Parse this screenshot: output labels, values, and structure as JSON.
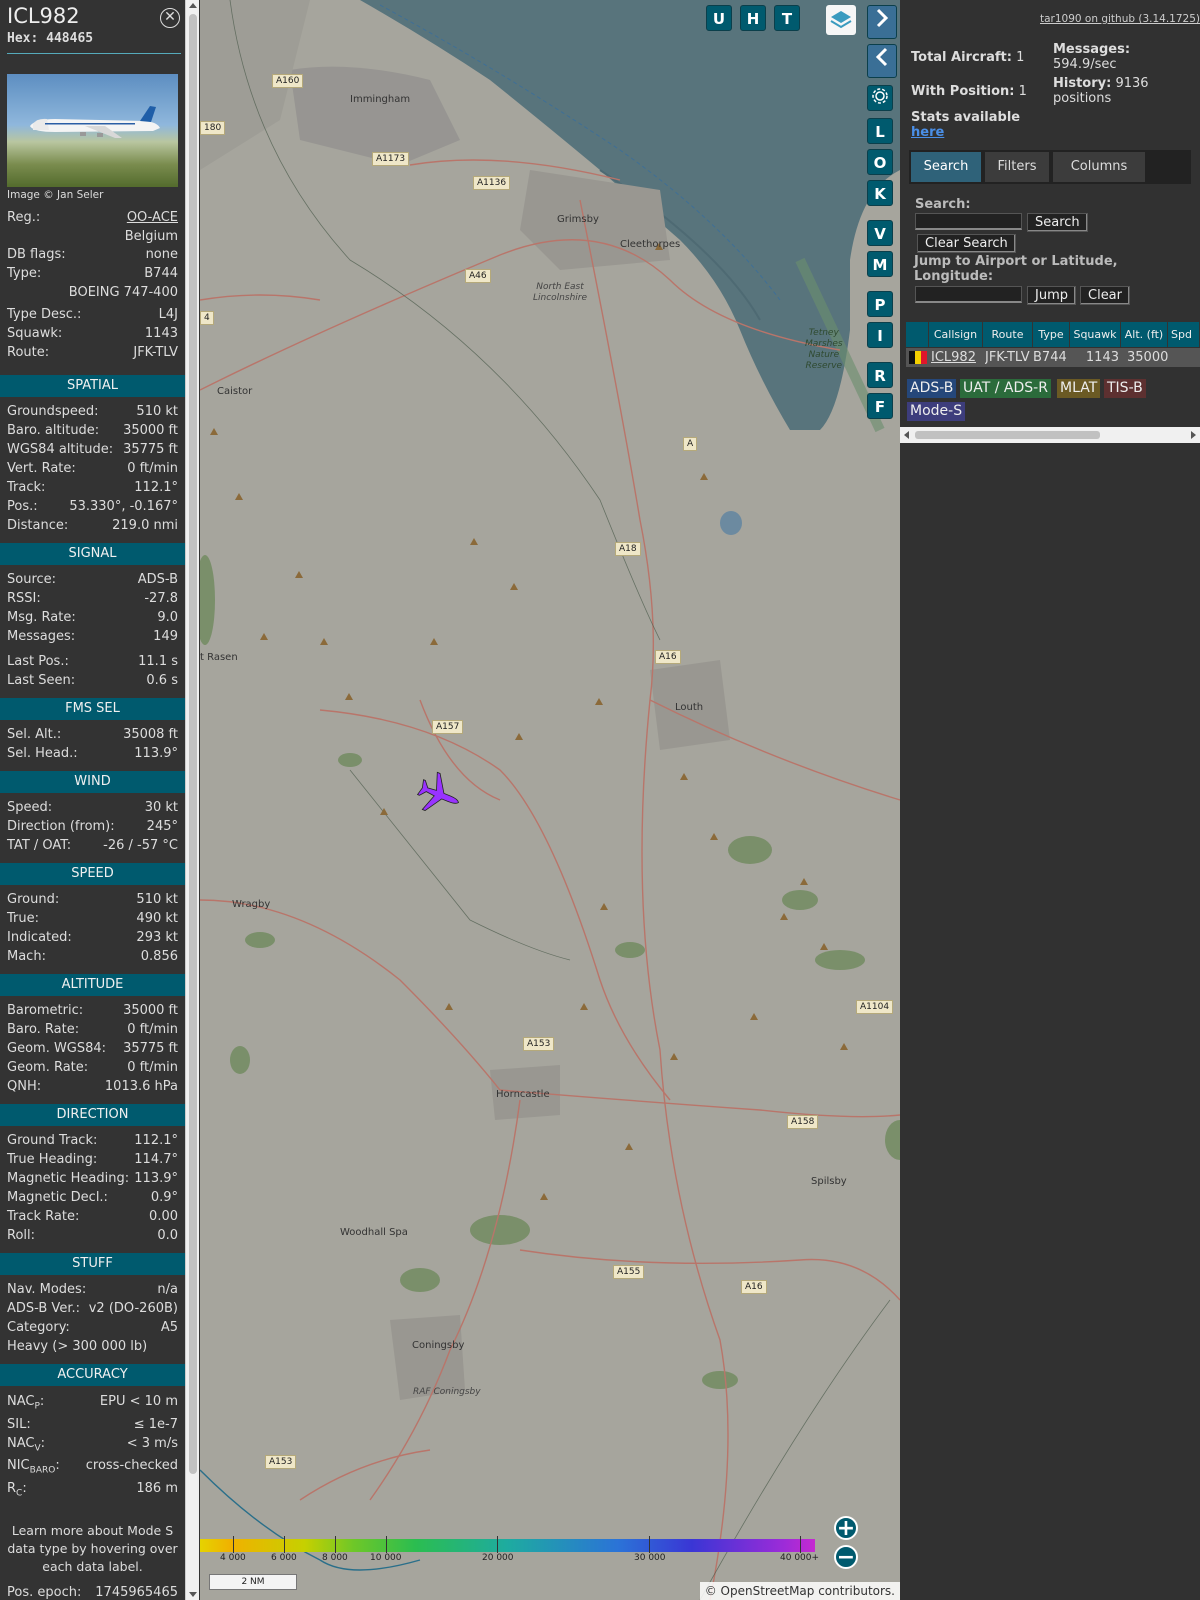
{
  "aircraft": {
    "callsign": "ICL982",
    "hex": "Hex: 448465",
    "image_credit": "Image © Jan Seler",
    "reg_label": "Reg.:",
    "reg": "OO-ACE",
    "country": "Belgium",
    "dbflags_label": "DB flags:",
    "dbflags": "none",
    "type_label": "Type:",
    "type": "B744",
    "type_name": "BOEING 747-400",
    "typedesc_label": "Type Desc.:",
    "typedesc": "L4J",
    "squawk_label": "Squawk:",
    "squawk": "1143",
    "route_label": "Route:",
    "route": "JFK-TLV"
  },
  "sections": {
    "spatial": "SPATIAL",
    "signal": "SIGNAL",
    "fms": "FMS SEL",
    "wind": "WIND",
    "speed": "SPEED",
    "altitude": "ALTITUDE",
    "direction": "DIRECTION",
    "stuff": "STUFF",
    "accuracy": "ACCURACY"
  },
  "spatial": [
    {
      "k": "Groundspeed:",
      "v": "510 kt"
    },
    {
      "k": "Baro. altitude:",
      "v": "35000 ft"
    },
    {
      "k": "WGS84 altitude:",
      "v": "35775 ft"
    },
    {
      "k": "Vert. Rate:",
      "v": "0 ft/min"
    },
    {
      "k": "Track:",
      "v": "112.1°"
    },
    {
      "k": "Pos.:",
      "v": "53.330°, -0.167°"
    },
    {
      "k": "Distance:",
      "v": "219.0 nmi"
    }
  ],
  "signal": [
    {
      "k": "Source:",
      "v": "ADS-B"
    },
    {
      "k": "RSSI:",
      "v": "-27.8"
    },
    {
      "k": "Msg. Rate:",
      "v": "9.0"
    },
    {
      "k": "Messages:",
      "v": "149"
    },
    {
      "k": "Last Pos.:",
      "v": "11.1 s"
    },
    {
      "k": "Last Seen:",
      "v": "0.6 s"
    }
  ],
  "fms": [
    {
      "k": "Sel. Alt.:",
      "v": "35008 ft"
    },
    {
      "k": "Sel. Head.:",
      "v": "113.9°"
    }
  ],
  "wind": [
    {
      "k": "Speed:",
      "v": "30 kt"
    },
    {
      "k": "Direction (from):",
      "v": "245°"
    },
    {
      "k": "TAT / OAT:",
      "v": "-26 / -57 °C"
    }
  ],
  "speed": [
    {
      "k": "Ground:",
      "v": "510 kt"
    },
    {
      "k": "True:",
      "v": "490 kt"
    },
    {
      "k": "Indicated:",
      "v": "293 kt"
    },
    {
      "k": "Mach:",
      "v": "0.856"
    }
  ],
  "altitude": [
    {
      "k": "Barometric:",
      "v": "35000 ft"
    },
    {
      "k": "Baro. Rate:",
      "v": "0 ft/min"
    },
    {
      "k": "Geom. WGS84:",
      "v": "35775 ft"
    },
    {
      "k": "Geom. Rate:",
      "v": "0 ft/min"
    },
    {
      "k": "QNH:",
      "v": "1013.6 hPa"
    }
  ],
  "direction": [
    {
      "k": "Ground Track:",
      "v": "112.1°"
    },
    {
      "k": "True Heading:",
      "v": "114.7°"
    },
    {
      "k": "Magnetic Heading:",
      "v": "113.9°"
    },
    {
      "k": "Magnetic Decl.:",
      "v": "0.9°"
    },
    {
      "k": "Track Rate:",
      "v": "0.00"
    },
    {
      "k": "Roll:",
      "v": "0.0"
    }
  ],
  "stuff": [
    {
      "k": "Nav. Modes:",
      "v": "n/a"
    },
    {
      "k": "ADS-B Ver.:",
      "v": "v2 (DO-260B)"
    },
    {
      "k": "Category:",
      "v": "A5"
    },
    {
      "k": "Heavy (> 300 000 lb)",
      "v": ""
    }
  ],
  "accuracy": {
    "nacp_k": "NAC",
    "nacp_sub": "P",
    "nacp_v": "EPU < 10 m",
    "sil_k": "SIL:",
    "sil_v": "≤ 1e-7",
    "nacv_k": "NAC",
    "nacv_sub": "V",
    "nacv_v": "< 3 m/s",
    "nic_k": "NIC",
    "nic_sub": "BARO",
    "nic_v": "cross-checked",
    "rc_k": "R",
    "rc_sub": "C",
    "rc_v": "186 m"
  },
  "learn_more": "Learn more about Mode S data type by hovering over each data label.",
  "pos_epoch": {
    "k": "Pos. epoch:",
    "v": "1745965465"
  },
  "map": {
    "places": [
      "Immingham",
      "Grimsby",
      "Cleethorpes",
      "North East Lincolnshire",
      "Caistor",
      "Market Rasen",
      "Louth",
      "Wragby",
      "Horncastle",
      "Spilsby",
      "Woodhall Spa",
      "Coningsby",
      "RAF Coningsby",
      "Tetney Marshes Nature Reserve"
    ],
    "place_display": {
      "rasen": "t Rasen",
      "nel1": "North East",
      "nel2": "Lincolnshire",
      "tet1": "Tetney",
      "tet2": "Marshes",
      "tet3": "Nature",
      "tet4": "Reserve"
    },
    "roads": [
      "A160",
      "A1173",
      "A1136",
      "A46",
      "A18",
      "A16",
      "A157",
      "A153",
      "A1104",
      "A158",
      "A155",
      "A16",
      "A153",
      "A",
      "180",
      "4"
    ],
    "toolbar": [
      "U",
      "H",
      "T"
    ],
    "side_buttons": [
      "L",
      "O",
      "K",
      "V",
      "M",
      "P",
      "I",
      "R",
      "F"
    ],
    "color_scale_labels": [
      "4 000",
      "6 000",
      "8 000",
      "10 000",
      "20 000",
      "30 000",
      "40 000+"
    ],
    "scale": "2 NM",
    "attribution": "© OpenStreetMap contributors."
  },
  "stats": {
    "github": "tar1090 on github (3.14.1725)",
    "total_label": "Total Aircraft:",
    "total": "1",
    "messages_label": "Messages:",
    "messages": "594.9/sec",
    "with_pos_label": "With Position:",
    "with_pos": "1",
    "history_label": "History:",
    "history": "9136",
    "history_unit": "positions",
    "stats_avail": "Stats available",
    "here": "here"
  },
  "tabs": [
    "Search",
    "Filters",
    "Columns"
  ],
  "search": {
    "search_label": "Search:",
    "search_btn": "Search",
    "clear_btn": "Clear Search",
    "jump_label": "Jump to Airport or Latitude, Longitude:",
    "jump_btn": "Jump",
    "clear2_btn": "Clear"
  },
  "table": {
    "headers": [
      "Callsign",
      "Route",
      "Type",
      "Squawk",
      "Alt. (ft)",
      "Spd"
    ],
    "row": [
      "ICL982",
      "JFK-TLV",
      "B744",
      "1143",
      "35000"
    ]
  },
  "sources": [
    "ADS-B",
    "UAT / ADS-R",
    "MLAT",
    "TIS-B",
    "Mode-S"
  ],
  "colors": {
    "accent": "#005a6e",
    "aircraft": "#9933ff",
    "adsb": "#25477a",
    "uat": "#2b6b3b",
    "mlat": "#6b5a24",
    "tisb": "#5d3030",
    "modes": "#3d3d7c"
  }
}
